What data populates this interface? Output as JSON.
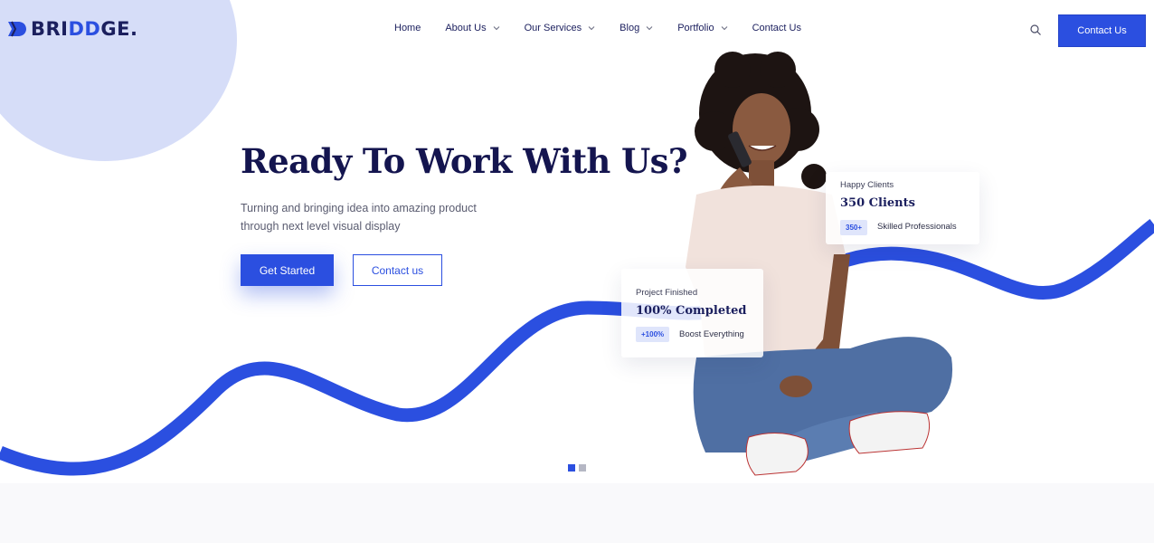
{
  "brand": {
    "logo_text_a": "BRI",
    "logo_text_b": "DD",
    "logo_text_c": "GE."
  },
  "nav": {
    "items": [
      {
        "label": "Home",
        "has_dropdown": false
      },
      {
        "label": "About Us",
        "has_dropdown": true
      },
      {
        "label": "Our Services",
        "has_dropdown": true
      },
      {
        "label": "Blog",
        "has_dropdown": true
      },
      {
        "label": "Portfolio",
        "has_dropdown": true
      },
      {
        "label": "Contact Us",
        "has_dropdown": false
      }
    ],
    "search_icon": "search-icon",
    "cta_label": "Contact Us"
  },
  "hero": {
    "title": "Ready To Work With Us?",
    "subtitle": "Turning and bringing idea into amazing product through next level visual display",
    "primary_button": "Get Started",
    "secondary_button": "Contact us"
  },
  "cards": {
    "clients": {
      "kicker": "Happy Clients",
      "headline": "350 Clients",
      "badge": "350+",
      "note": "Skilled Professionals"
    },
    "project": {
      "kicker": "Project Finished",
      "headline": "100% Completed",
      "badge": "+100%",
      "note": "Boost Everything"
    }
  },
  "slider": {
    "total": 2,
    "active": 1
  },
  "colors": {
    "accent": "#2b4fe0",
    "heading": "#14154f",
    "circle": "#d6ddf8"
  }
}
